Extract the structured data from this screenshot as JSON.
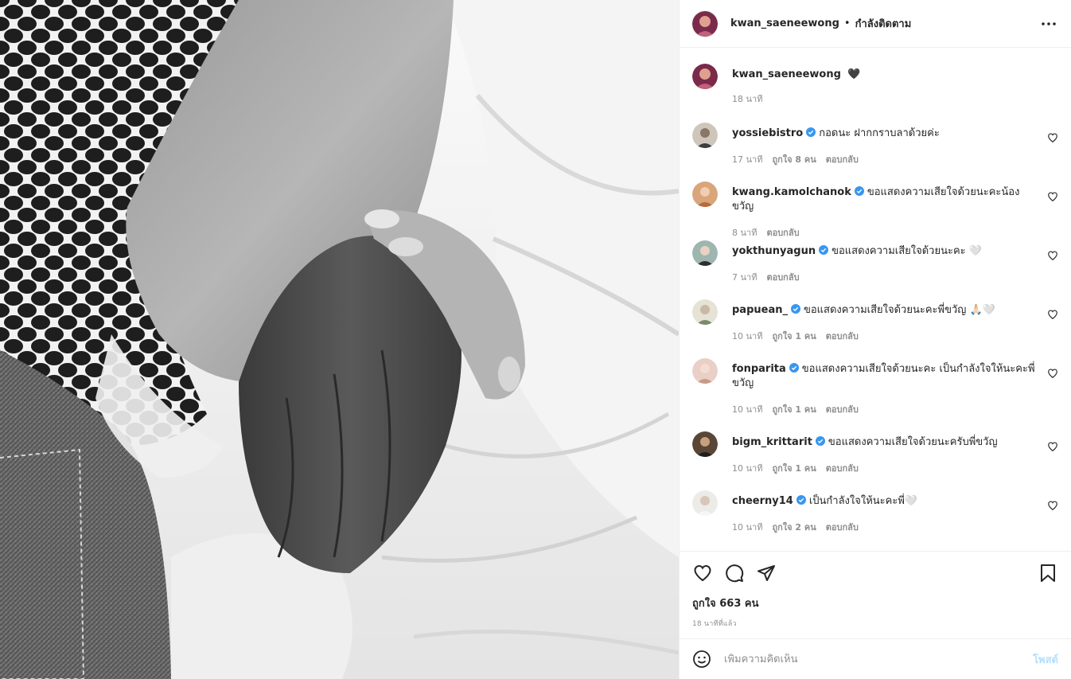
{
  "colors": {
    "verified": "#3897f0",
    "post_disabled": "#b2dffc",
    "muted": "#8e8e8e"
  },
  "header": {
    "username": "kwan_saeneewong",
    "separator": "•",
    "follow_status": "กำลังติดตาม",
    "more_icon": "more-options-icon"
  },
  "caption": {
    "username": "kwan_saeneewong",
    "text": "🖤",
    "time": "18 นาที"
  },
  "comments": [
    {
      "username": "yossiebistro",
      "text": "กอดนะ ฝากกราบลาด้วยค่ะ",
      "time": "17 นาที",
      "likes": "ถูกใจ 8 คน",
      "reply": "ตอบกลับ"
    },
    {
      "username": "kwang.kamolchanok",
      "text": "ขอแสดงความเสียใจด้วยนะคะน้องขวัญ",
      "time": "8 นาที",
      "likes": "",
      "reply": "ตอบกลับ"
    },
    {
      "username": "yokthunyagun",
      "text": "ขอแสดงความเสียใจด้วยนะคะ 🤍",
      "time": "7 นาที",
      "likes": "",
      "reply": "ตอบกลับ"
    },
    {
      "username": "papuean_",
      "text": "ขอแสดงความเสียใจด้วยนะคะพี่ขวัญ 🙏🏻🤍",
      "time": "10 นาที",
      "likes": "ถูกใจ 1 คน",
      "reply": "ตอบกลับ"
    },
    {
      "username": "fonparita",
      "text": "ขอแสดงความเสียใจด้วยนะคะ เป็นกำลังใจให้นะคะพี่ขวัญ",
      "time": "10 นาที",
      "likes": "ถูกใจ 1 คน",
      "reply": "ตอบกลับ"
    },
    {
      "username": "bigm_krittarit",
      "text": "ขอแสดงความเสียใจด้วยนะครับพี่ขวัญ",
      "time": "10 นาที",
      "likes": "ถูกใจ 1 คน",
      "reply": "ตอบกลับ"
    },
    {
      "username": "cheerny14",
      "text": "เป็นกำลังใจให้นะคะพี่🤍",
      "time": "10 นาที",
      "likes": "ถูกใจ 2 คน",
      "reply": "ตอบกลับ"
    }
  ],
  "actions": {
    "like_icon": "heart-icon",
    "comment_icon": "comment-icon",
    "share_icon": "share-icon",
    "save_icon": "bookmark-icon"
  },
  "likes_text": "ถูกใจ 663 คน",
  "posted_ago": "18 นาทีที่แล้ว",
  "add_comment": {
    "placeholder": "เพิ่มความคิดเห็น",
    "post_label": "โพสต์",
    "emoji_icon": "emoji-icon"
  }
}
